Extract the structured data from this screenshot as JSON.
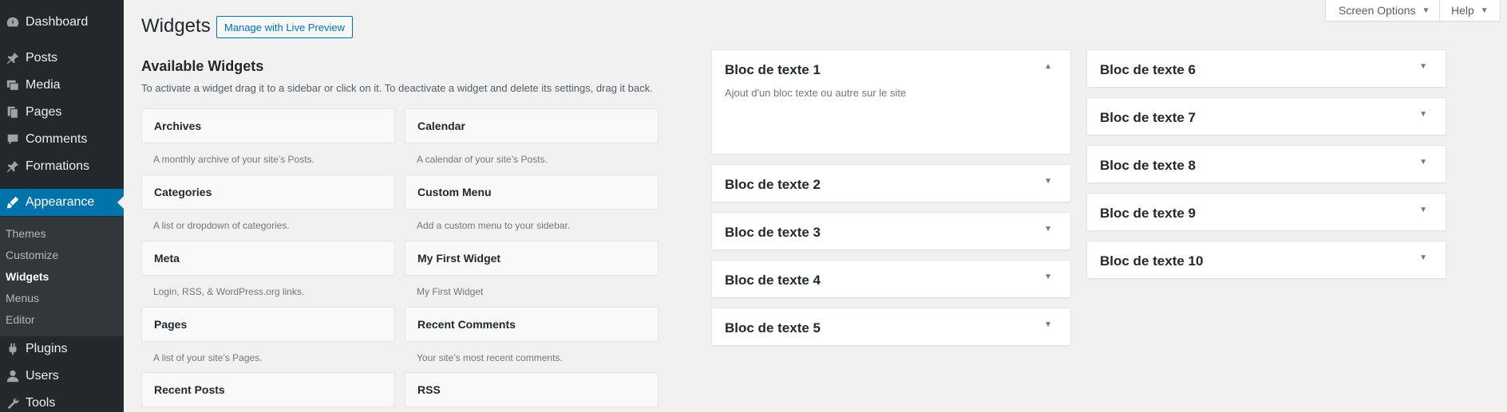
{
  "sidebar": {
    "items": [
      {
        "label": "Dashboard",
        "icon": "dashboard-icon"
      },
      {
        "label": "Posts",
        "icon": "pin-icon"
      },
      {
        "label": "Media",
        "icon": "media-icon"
      },
      {
        "label": "Pages",
        "icon": "pages-icon"
      },
      {
        "label": "Comments",
        "icon": "comment-icon"
      },
      {
        "label": "Formations",
        "icon": "pin-icon"
      },
      {
        "label": "Appearance",
        "icon": "brush-icon"
      },
      {
        "label": "Plugins",
        "icon": "plugin-icon"
      },
      {
        "label": "Users",
        "icon": "user-icon"
      },
      {
        "label": "Tools",
        "icon": "wrench-icon"
      }
    ],
    "submenu": [
      "Themes",
      "Customize",
      "Widgets",
      "Menus",
      "Editor"
    ],
    "current_sub": "Widgets"
  },
  "top_buttons": {
    "screen_options": "Screen Options",
    "help": "Help"
  },
  "header": {
    "title": "Widgets",
    "live_preview": "Manage with Live Preview"
  },
  "available": {
    "title": "Available Widgets",
    "description": "To activate a widget drag it to a sidebar or click on it. To deactivate a widget and delete its settings, drag it back.",
    "widgets": [
      {
        "name": "Archives",
        "desc": "A monthly archive of your site’s Posts."
      },
      {
        "name": "Calendar",
        "desc": "A calendar of your site’s Posts."
      },
      {
        "name": "Categories",
        "desc": "A list or dropdown of categories."
      },
      {
        "name": "Custom Menu",
        "desc": "Add a custom menu to your sidebar."
      },
      {
        "name": "Meta",
        "desc": "Login, RSS, & WordPress.org links."
      },
      {
        "name": "My First Widget",
        "desc": "My First Widget"
      },
      {
        "name": "Pages",
        "desc": "A list of your site’s Pages."
      },
      {
        "name": "Recent Comments",
        "desc": "Your site’s most recent comments."
      },
      {
        "name": "Recent Posts",
        "desc": ""
      },
      {
        "name": "RSS",
        "desc": ""
      }
    ]
  },
  "sidebars": {
    "col1": [
      {
        "title": "Bloc de texte 1",
        "desc": "Ajout d'un bloc texte ou autre sur le site",
        "expanded": true
      },
      {
        "title": "Bloc de texte 2"
      },
      {
        "title": "Bloc de texte 3"
      },
      {
        "title": "Bloc de texte 4"
      },
      {
        "title": "Bloc de texte 5"
      }
    ],
    "col2": [
      {
        "title": "Bloc de texte 6"
      },
      {
        "title": "Bloc de texte 7"
      },
      {
        "title": "Bloc de texte 8"
      },
      {
        "title": "Bloc de texte 9"
      },
      {
        "title": "Bloc de texte 10"
      }
    ]
  },
  "colors": {
    "admin_bg": "#23282d",
    "active": "#0073aa",
    "page_bg": "#f1f1f1"
  }
}
